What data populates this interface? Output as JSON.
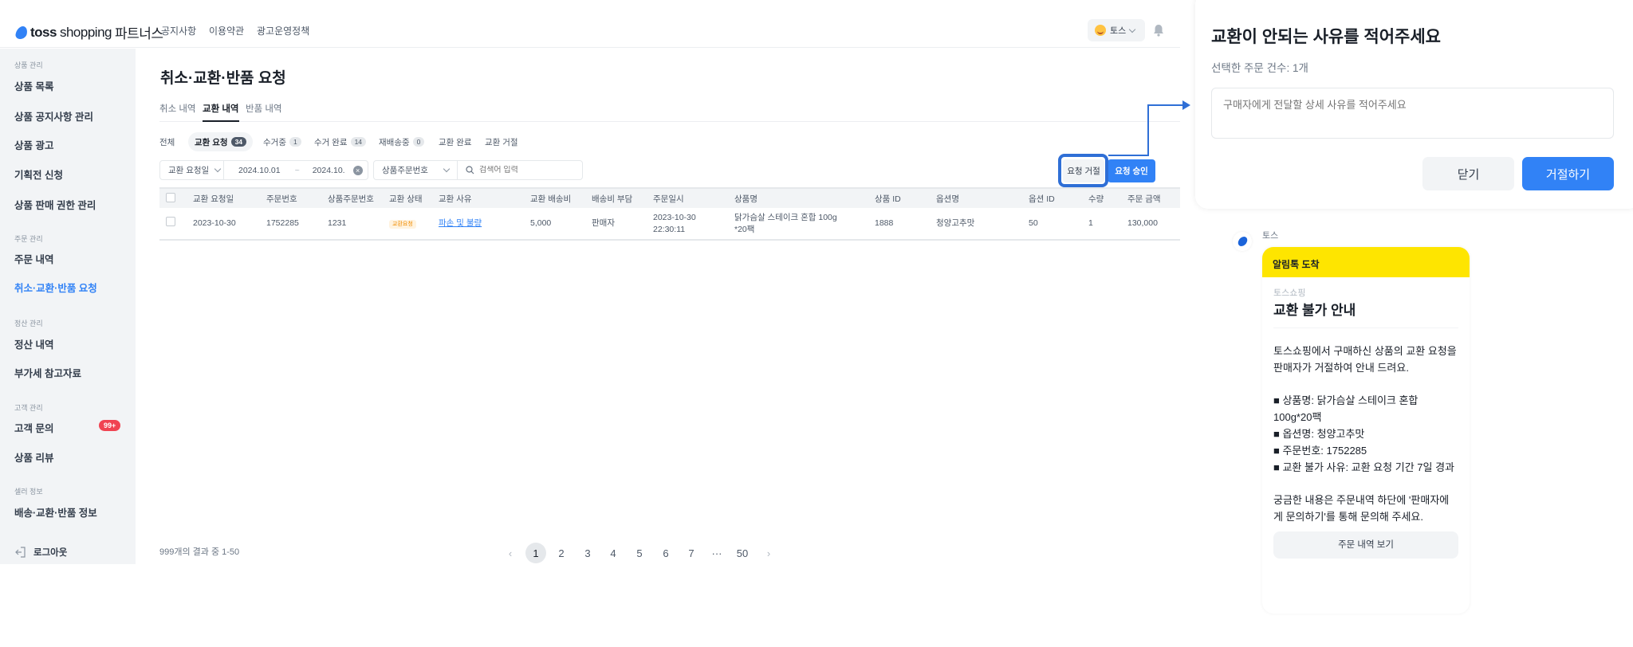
{
  "header": {
    "logo_brand": "toss",
    "logo_product": "shopping",
    "logo_suffix": "파트너스",
    "nav": [
      "공지사항",
      "이용약관",
      "광고운영정책"
    ],
    "user": "토스"
  },
  "sidebar": {
    "sections": [
      "상품 관리",
      "주문 관리",
      "정산 관리",
      "고객 관리",
      "셀러 정보"
    ],
    "items": [
      "상품 목록",
      "상품 공지사항 관리",
      "상품 광고",
      "기획전 신청",
      "상품 판매 권한 관리",
      "주문 내역",
      "취소·교환·반품 요청",
      "정산 내역",
      "부가세 참고자료",
      "고객 문의",
      "상품 리뷰",
      "배송·교환·반품 정보"
    ],
    "badge": "99+",
    "logout": "로그아웃",
    "active": "취소·교환·반품 요청"
  },
  "main": {
    "title": "취소·교환·반품 요청",
    "tabs": [
      "취소 내역",
      "교환 내역",
      "반품 내역"
    ],
    "active_tab": "교환 내역",
    "chips": [
      {
        "label": "전체"
      },
      {
        "label": "교환 요청",
        "count": "34"
      },
      {
        "label": "수거중",
        "count": "1"
      },
      {
        "label": "수거 완료",
        "count": "14"
      },
      {
        "label": "재배송중",
        "count": "0"
      },
      {
        "label": "교환 완료"
      },
      {
        "label": "교환 거절"
      }
    ],
    "filters": {
      "date_type": "교환 요청일",
      "date_from": "2024.10.01",
      "date_sep": "~",
      "date_to": "2024.10.",
      "search_type": "상품주문번호",
      "search_placeholder": "검색어 입력"
    },
    "buttons": {
      "reject": "요청 거절",
      "approve": "요청 승인"
    },
    "table": {
      "headers": [
        "교환 요청일",
        "주문번호",
        "상품주문번호",
        "교환 상태",
        "교환 사유",
        "교환 배송비",
        "배송비 부담",
        "주문일시",
        "상품명",
        "상품 ID",
        "옵션명",
        "옵션 ID",
        "수량",
        "주문 금액"
      ],
      "rows": [
        {
          "date": "2023-10-30",
          "order_no": "1752285",
          "product_order_no": "1231",
          "status": "교환요청",
          "reason": "파손 및 불량",
          "fee": "5,000",
          "payer": "판매자",
          "ordered_at": "2023-10-30 22:30:11",
          "product": "닭가슴살 스테이크 혼합 100g *20팩",
          "product_id": "1888",
          "option": "청양고추맛",
          "option_id": "50",
          "qty": "1",
          "amount": "130,000"
        }
      ]
    },
    "pagination": {
      "summary": "999개의 결과 중 1-50",
      "pages": [
        "1",
        "2",
        "3",
        "4",
        "5",
        "6",
        "7",
        "···",
        "50"
      ],
      "current": "1"
    }
  },
  "modal": {
    "title": "교환이 안되는 사유를 적어주세요",
    "subtitle": "선택한 주문 건수: 1개",
    "placeholder": "구매자에게 전달할 상세 사유를 적어주세요",
    "close": "닫기",
    "reject": "거절하기"
  },
  "kakao": {
    "sender": "토스",
    "header": "알림톡 도착",
    "brand": "토스쇼핑",
    "title": "교환 불가 안내",
    "intro": "토스쇼핑에서 구매하신 상품의 교환 요청을 판매자가 거절하여 안내 드려요.",
    "lines": [
      "■ 상품명: 닭가슴살 스테이크 혼합 100g*20팩",
      "■ 옵션명: 청양고추맛",
      "■ 주문번호: 1752285",
      "■ 교환 불가 사유: 교환 요청 기간 7일 경과"
    ],
    "outro": "궁금한 내용은 주문내역 하단에 '판매자에게 문의하기'를 통해 문의해 주세요.",
    "button": "주문 내역 보기"
  },
  "colors": {
    "primary": "#3182f6",
    "kakao_yellow": "#fee500",
    "badge_red": "#f04452",
    "highlight": "#2f6fd6"
  }
}
